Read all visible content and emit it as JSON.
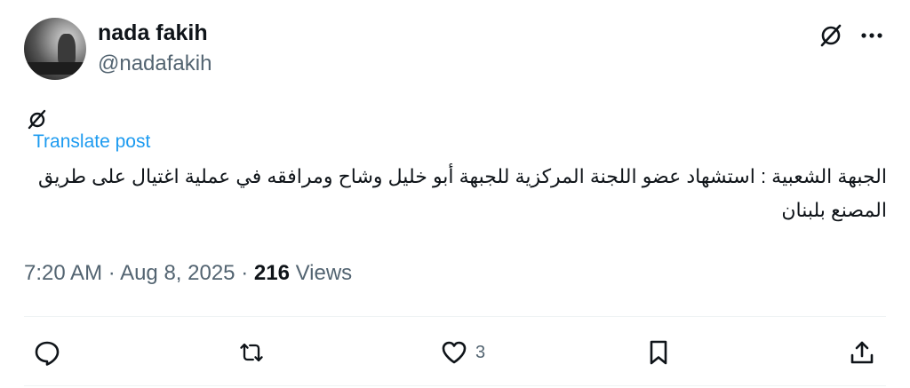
{
  "author": {
    "name": "nada fakih",
    "handle": "@nadafakih"
  },
  "post": {
    "translate_label": "Translate post",
    "text": "الجبهة الشعبية : استشهاد عضو اللجنة المركزية للجبهة أبو خليل وشاح ومرافقه في عملية اغتيال على طريق المصنع بلبنان"
  },
  "meta": {
    "time": "7:20 AM",
    "date": "Aug 8, 2025",
    "views_count": "216",
    "views_label": "Views"
  },
  "actions": {
    "like_count": "3"
  },
  "icons": {
    "header": [
      "grok-icon",
      "more-icon"
    ],
    "language": "language-icon",
    "actions": [
      "reply-icon",
      "repost-icon",
      "like-icon",
      "bookmark-icon",
      "share-icon"
    ]
  },
  "colors": {
    "text_primary": "#0f1419",
    "text_secondary": "#536471",
    "link": "#1d9bf0",
    "divider": "#eff3f4"
  }
}
